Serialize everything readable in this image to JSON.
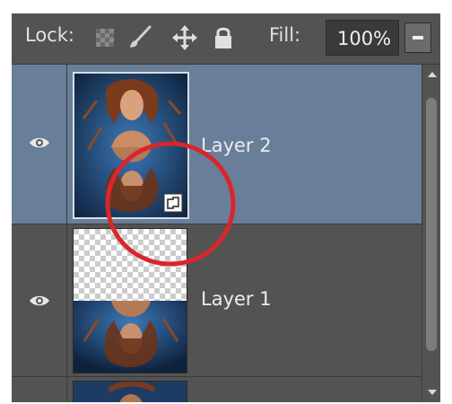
{
  "toolbar": {
    "lock_label": "Lock:",
    "lock_icons": [
      "lock-transparent-pixels-icon",
      "lock-image-pixels-icon",
      "lock-position-icon",
      "lock-all-icon"
    ],
    "fill_label": "Fill:",
    "fill_value": "100%",
    "fill_dropdown_icon": "chevron-down-icon"
  },
  "layers": [
    {
      "name": "Layer 2",
      "visible": true,
      "selected": true,
      "smart_object": true
    },
    {
      "name": "Layer 1",
      "visible": true,
      "selected": false,
      "smart_object": false
    }
  ],
  "colors": {
    "panel_bg": "#535353",
    "selected_row": "#697f99",
    "annotation_circle": "#d9262a"
  }
}
